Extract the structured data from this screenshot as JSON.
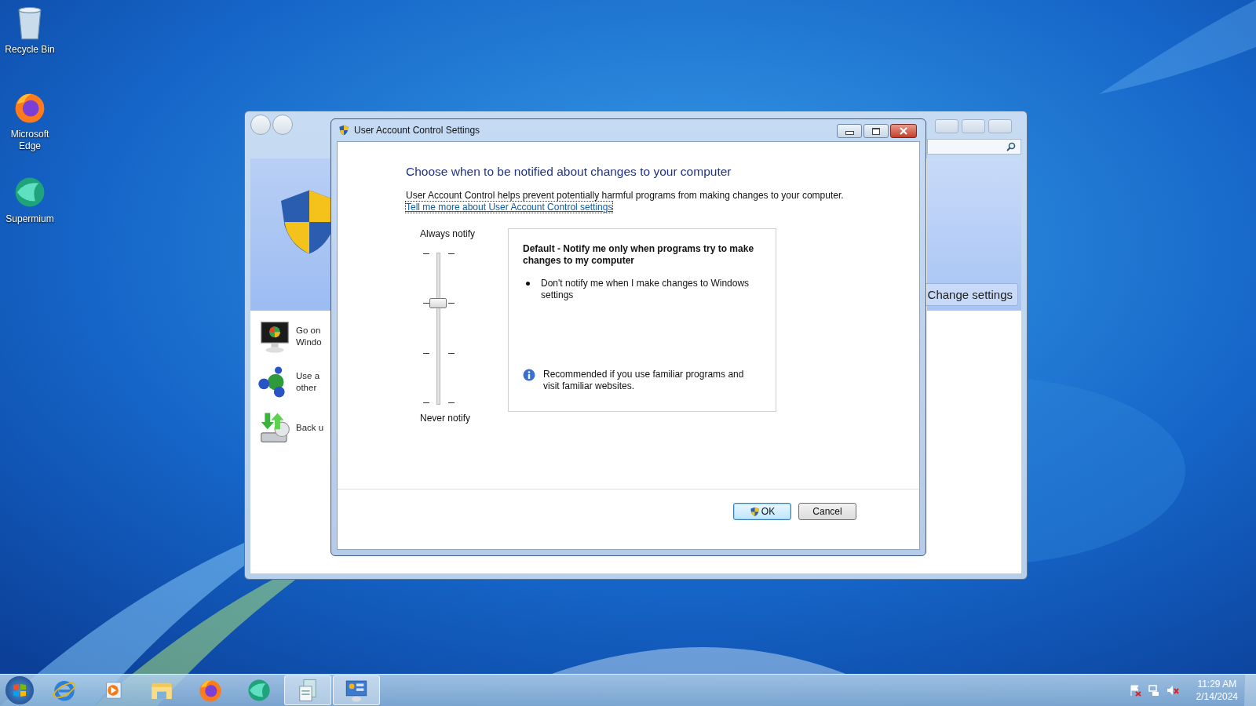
{
  "desktop_icons": [
    {
      "label": "Recycle Bin",
      "kind": "bin"
    },
    {
      "label": "Microsoft Edge",
      "kind": "fox"
    },
    {
      "label": "Supermium",
      "kind": "orb"
    }
  ],
  "back_window": {
    "items": [
      {
        "kind": "monitor",
        "lines": [
          "Go on",
          "Windo"
        ]
      },
      {
        "kind": "network",
        "lines": [
          "Use a",
          "other"
        ]
      },
      {
        "kind": "backup",
        "lines": [
          "Back u"
        ]
      }
    ],
    "button": "Change settings"
  },
  "dialog": {
    "title": "User Account Control Settings",
    "heading": "Choose when to be notified about changes to your computer",
    "description": "User Account Control helps prevent potentially harmful programs from making changes to your computer.",
    "link": "Tell me more about User Account Control settings",
    "slider": {
      "top_label": "Always notify",
      "bottom_label": "Never notify",
      "level": 0.67
    },
    "info": {
      "title": "Default - Notify me only when programs try to make changes to my computer",
      "bullets": [
        "Don't notify me when I make changes to Windows settings"
      ],
      "note": "Recommended if you use familiar programs and visit familiar websites."
    },
    "buttons": [
      {
        "label": "OK",
        "kind": "shield",
        "focused": true
      },
      {
        "label": "Cancel",
        "kind": "plain",
        "focused": false
      }
    ]
  },
  "taskbar": {
    "apps": [
      {
        "kind": "ie",
        "running": false
      },
      {
        "kind": "media",
        "running": false
      },
      {
        "kind": "folder",
        "running": false
      },
      {
        "kind": "fox",
        "running": false
      },
      {
        "kind": "orb",
        "running": false
      },
      {
        "kind": "doc",
        "running": true
      },
      {
        "kind": "panel",
        "running": true
      }
    ],
    "clock": {
      "time": "11:29 AM",
      "date": "2/14/2024"
    }
  }
}
